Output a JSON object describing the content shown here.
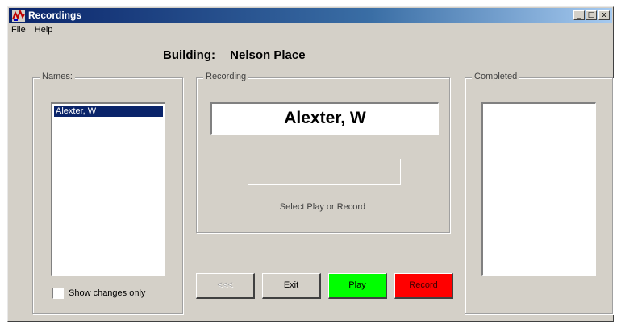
{
  "window": {
    "title": "Recordings",
    "minimize": "_",
    "maximize": "□",
    "close": "x"
  },
  "menu": {
    "file": "File",
    "help": "Help"
  },
  "building": {
    "label": "Building:",
    "value": "Nelson Place"
  },
  "names": {
    "label": "Names:",
    "items": [
      "Alexter, W"
    ],
    "show_changes_label": "Show changes only",
    "show_changes_checked": false
  },
  "recording": {
    "label": "Recording",
    "current_name": "Alexter, W",
    "status": "Select Play or Record"
  },
  "completed": {
    "label": "Completed"
  },
  "buttons": {
    "back": "<<<",
    "exit": "Exit",
    "play": "Play",
    "record": "Record"
  },
  "colors": {
    "title_bar": "#0a246a",
    "play": "#00ff00",
    "record": "#ff0000",
    "selection": "#0a246a"
  }
}
